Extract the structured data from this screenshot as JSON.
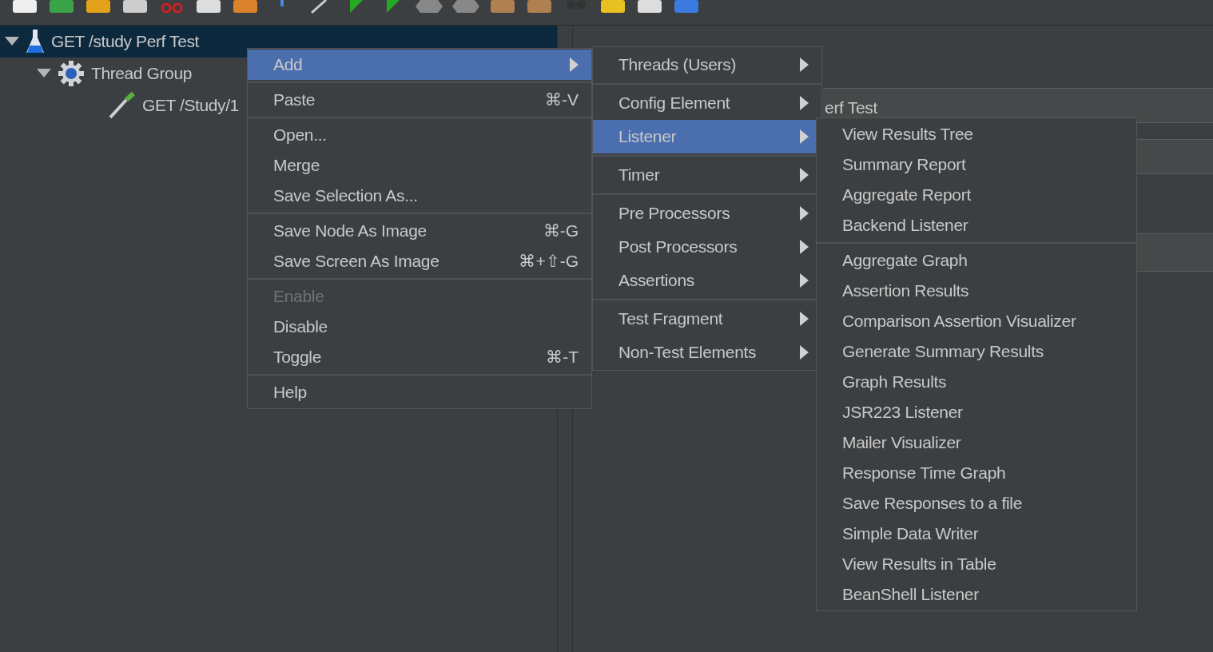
{
  "tree": {
    "items": [
      {
        "label": "GET /study Perf Test",
        "selected": true,
        "expanded": true,
        "children": [
          {
            "label": "Thread Group",
            "selected": false,
            "expanded": true,
            "children": [
              {
                "label": "GET /Study/1",
                "selected": false
              }
            ]
          }
        ]
      }
    ]
  },
  "detail_panel": {
    "name_field": {
      "value": "erf Test"
    }
  },
  "context_menu": {
    "items": [
      {
        "kind": "item",
        "label": "Add",
        "selected": true,
        "disabled": false,
        "submenu": true
      },
      {
        "kind": "separator"
      },
      {
        "kind": "item",
        "label": "Paste",
        "shortcut": "⌘-V",
        "selected": false,
        "disabled": false,
        "submenu": false
      },
      {
        "kind": "separator"
      },
      {
        "kind": "item",
        "label": "Open...",
        "selected": false,
        "disabled": false,
        "submenu": false
      },
      {
        "kind": "item",
        "label": "Merge",
        "selected": false,
        "disabled": false,
        "submenu": false
      },
      {
        "kind": "item",
        "label": "Save Selection As...",
        "selected": false,
        "disabled": false,
        "submenu": false
      },
      {
        "kind": "separator"
      },
      {
        "kind": "item",
        "label": "Save Node As Image",
        "shortcut": "⌘-G",
        "selected": false,
        "disabled": false,
        "submenu": false
      },
      {
        "kind": "item",
        "label": "Save Screen As Image",
        "shortcut": "⌘+⇧-G",
        "selected": false,
        "disabled": false,
        "submenu": false
      },
      {
        "kind": "separator"
      },
      {
        "kind": "item",
        "label": "Enable",
        "selected": false,
        "disabled": true,
        "submenu": false
      },
      {
        "kind": "item",
        "label": "Disable",
        "selected": false,
        "disabled": false,
        "submenu": false
      },
      {
        "kind": "item",
        "label": "Toggle",
        "shortcut": "⌘-T",
        "selected": false,
        "disabled": false,
        "submenu": false
      },
      {
        "kind": "separator"
      },
      {
        "kind": "item",
        "label": "Help",
        "selected": false,
        "disabled": false,
        "submenu": false
      }
    ]
  },
  "add_submenu": {
    "items": [
      {
        "kind": "item",
        "label": "Threads (Users)",
        "selected": false,
        "submenu": true
      },
      {
        "kind": "separator"
      },
      {
        "kind": "item",
        "label": "Config Element",
        "selected": false,
        "submenu": true
      },
      {
        "kind": "item",
        "label": "Listener",
        "selected": true,
        "submenu": true
      },
      {
        "kind": "separator"
      },
      {
        "kind": "item",
        "label": "Timer",
        "selected": false,
        "submenu": true
      },
      {
        "kind": "separator"
      },
      {
        "kind": "item",
        "label": "Pre Processors",
        "selected": false,
        "submenu": true
      },
      {
        "kind": "item",
        "label": "Post Processors",
        "selected": false,
        "submenu": true
      },
      {
        "kind": "item",
        "label": "Assertions",
        "selected": false,
        "submenu": true
      },
      {
        "kind": "separator"
      },
      {
        "kind": "item",
        "label": "Test Fragment",
        "selected": false,
        "submenu": true
      },
      {
        "kind": "item",
        "label": "Non-Test Elements",
        "selected": false,
        "submenu": true
      }
    ]
  },
  "listener_submenu": {
    "items": [
      {
        "kind": "item",
        "label": "View Results Tree",
        "selected": false
      },
      {
        "kind": "item",
        "label": "Summary Report",
        "selected": false
      },
      {
        "kind": "item",
        "label": "Aggregate Report",
        "selected": false
      },
      {
        "kind": "item",
        "label": "Backend Listener",
        "selected": false
      },
      {
        "kind": "separator"
      },
      {
        "kind": "item",
        "label": "Aggregate Graph",
        "selected": false
      },
      {
        "kind": "item",
        "label": "Assertion Results",
        "selected": false
      },
      {
        "kind": "item",
        "label": "Comparison Assertion Visualizer",
        "selected": false
      },
      {
        "kind": "item",
        "label": "Generate Summary Results",
        "selected": false
      },
      {
        "kind": "item",
        "label": "Graph Results",
        "selected": false
      },
      {
        "kind": "item",
        "label": "JSR223 Listener",
        "selected": false
      },
      {
        "kind": "item",
        "label": "Mailer Visualizer",
        "selected": false
      },
      {
        "kind": "item",
        "label": "Response Time Graph",
        "selected": false
      },
      {
        "kind": "item",
        "label": "Save Responses to a file",
        "selected": false
      },
      {
        "kind": "item",
        "label": "Simple Data Writer",
        "selected": false
      },
      {
        "kind": "item",
        "label": "View Results in Table",
        "selected": false
      },
      {
        "kind": "item",
        "label": "BeanShell Listener",
        "selected": false
      }
    ]
  }
}
